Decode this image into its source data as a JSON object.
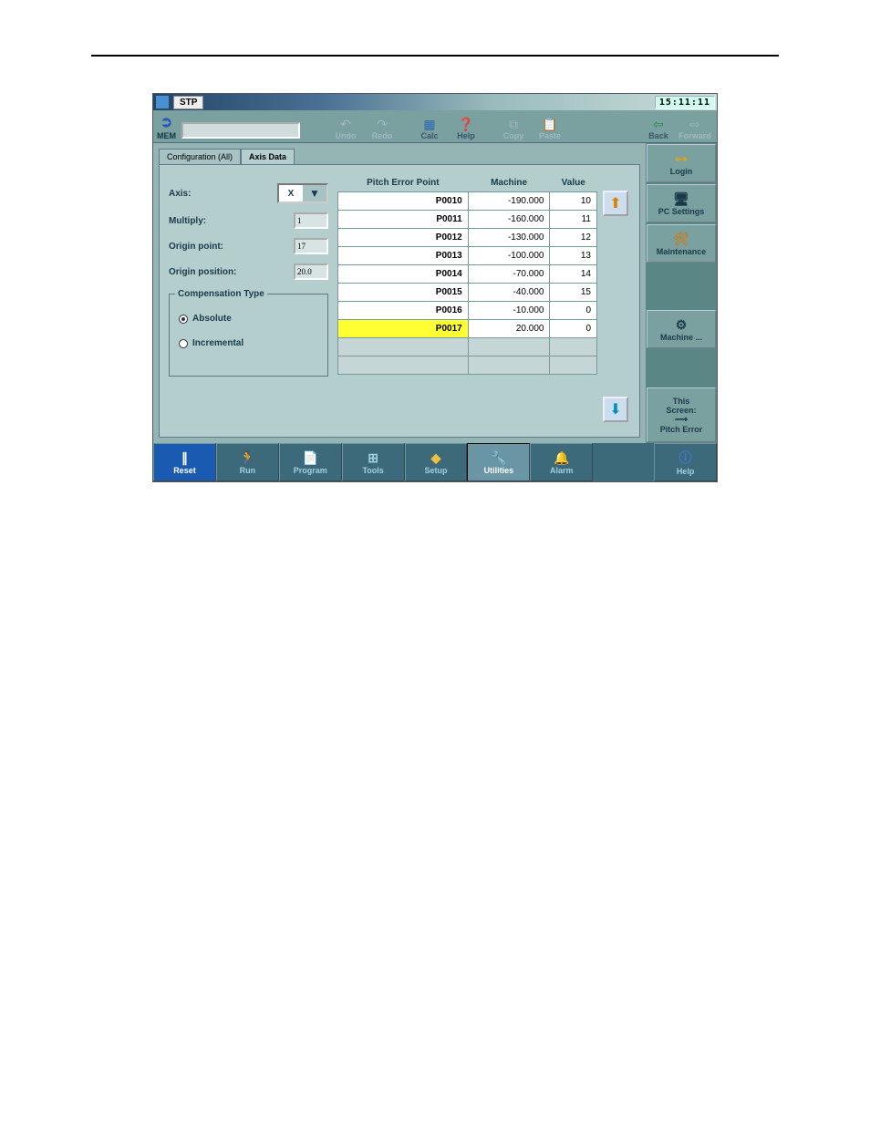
{
  "titlebar": {
    "mode": "STP",
    "clock": "15:11:11"
  },
  "toolbar": {
    "mem": "MEM",
    "undo": "Undo",
    "redo": "Redo",
    "calc": "Calc",
    "help": "Help",
    "copy": "Copy",
    "paste": "Paste",
    "back": "Back",
    "forward": "Forward"
  },
  "tabs": [
    "Configuration (All)",
    "Axis Data"
  ],
  "left": {
    "axis_label": "Axis:",
    "axis_value": "X",
    "multiply_label": "Multiply:",
    "multiply_value": "1",
    "origin_point_label": "Origin point:",
    "origin_point_value": "17",
    "origin_position_label": "Origin position:",
    "origin_position_value": "20.0",
    "comp_legend": "Compensation Type",
    "comp_absolute": "Absolute",
    "comp_incremental": "Incremental"
  },
  "table": {
    "headers": [
      "Pitch Error Point",
      "Machine",
      "Value"
    ],
    "rows": [
      {
        "point": "P0010",
        "machine": "-190.000",
        "value": "10",
        "selected": false
      },
      {
        "point": "P0011",
        "machine": "-160.000",
        "value": "11",
        "selected": false
      },
      {
        "point": "P0012",
        "machine": "-130.000",
        "value": "12",
        "selected": false
      },
      {
        "point": "P0013",
        "machine": "-100.000",
        "value": "13",
        "selected": false
      },
      {
        "point": "P0014",
        "machine": "-70.000",
        "value": "14",
        "selected": false
      },
      {
        "point": "P0015",
        "machine": "-40.000",
        "value": "15",
        "selected": false
      },
      {
        "point": "P0016",
        "machine": "-10.000",
        "value": "0",
        "selected": false
      },
      {
        "point": "P0017",
        "machine": "20.000",
        "value": "0",
        "selected": true
      }
    ],
    "empty_rows": 2
  },
  "side": {
    "login": "Login",
    "pc": "PC Settings",
    "maint": "Maintenance",
    "machine": "Machine ...",
    "this1": "This",
    "this2": "Screen:",
    "this3": "Pitch Error"
  },
  "bottom": {
    "reset": "Reset",
    "run": "Run",
    "program": "Program",
    "tools": "Tools",
    "setup": "Setup",
    "utilities": "Utilities",
    "alarm": "Alarm",
    "help": "Help"
  }
}
